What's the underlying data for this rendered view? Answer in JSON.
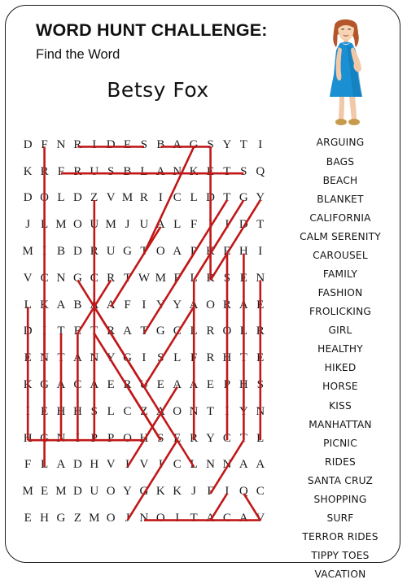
{
  "header": {
    "title": "WORD HUNT CHALLENGE:",
    "subtitle": "Find the Word",
    "puzzle_name": "Betsy Fox"
  },
  "illustration": {
    "name": "woman-in-blue-dress-illustration",
    "dress_color": "#1a8fd1",
    "hair_color": "#b4562a",
    "skin_color": "#f2c9a8",
    "shoe_color": "#c79a4e"
  },
  "grid": {
    "rows": 15,
    "cols": 15,
    "letters": [
      [
        "D",
        "F",
        "N",
        "R",
        "I",
        "D",
        "E",
        "S",
        "B",
        "A",
        "G",
        "S",
        "Y",
        "T",
        "I"
      ],
      [
        "K",
        "R",
        "F",
        "R",
        "U",
        "S",
        "B",
        "L",
        "A",
        "N",
        "K",
        "E",
        "T",
        "S",
        "Q"
      ],
      [
        "D",
        "O",
        "L",
        "D",
        "Z",
        "V",
        "M",
        "R",
        "I",
        "C",
        "L",
        "D",
        "T",
        "G",
        "Y"
      ],
      [
        "J",
        "L",
        "M",
        "O",
        "U",
        "M",
        "J",
        "U",
        "A",
        "L",
        "F",
        "I",
        "I",
        "D",
        "T"
      ],
      [
        "M",
        "I",
        "B",
        "D",
        "R",
        "U",
        "G",
        "T",
        "O",
        "A",
        "P",
        "K",
        "E",
        "H",
        "I"
      ],
      [
        "V",
        "C",
        "N",
        "G",
        "C",
        "R",
        "T",
        "W",
        "M",
        "F",
        "L",
        "R",
        "S",
        "E",
        "N"
      ],
      [
        "L",
        "K",
        "A",
        "B",
        "A",
        "A",
        "F",
        "I",
        "Y",
        "Y",
        "A",
        "O",
        "R",
        "A",
        "E"
      ],
      [
        "D",
        "I",
        "T",
        "E",
        "T",
        "R",
        "A",
        "T",
        "G",
        "C",
        "L",
        "R",
        "O",
        "L",
        "R"
      ],
      [
        "E",
        "N",
        "T",
        "A",
        "N",
        "Y",
        "G",
        "I",
        "S",
        "L",
        "F",
        "R",
        "H",
        "T",
        "E"
      ],
      [
        "K",
        "G",
        "A",
        "C",
        "A",
        "E",
        "R",
        "U",
        "E",
        "A",
        "A",
        "E",
        "P",
        "H",
        "S"
      ],
      [
        "I",
        "E",
        "H",
        "H",
        "S",
        "L",
        "C",
        "Z",
        "A",
        "O",
        "N",
        "T",
        "I",
        "Y",
        "N"
      ],
      [
        "H",
        "G",
        "N",
        "I",
        "P",
        "P",
        "O",
        "H",
        "S",
        "E",
        "R",
        "Y",
        "C",
        "T",
        "L"
      ],
      [
        "F",
        "L",
        "A",
        "D",
        "H",
        "V",
        "I",
        "V",
        "I",
        "C",
        "L",
        "N",
        "N",
        "A",
        "A"
      ],
      [
        "M",
        "E",
        "M",
        "D",
        "U",
        "O",
        "Y",
        "G",
        "K",
        "K",
        "J",
        "F",
        "I",
        "Q",
        "C"
      ],
      [
        "E",
        "H",
        "G",
        "Z",
        "M",
        "O",
        "J",
        "N",
        "O",
        "I",
        "T",
        "A",
        "C",
        "A",
        "V"
      ]
    ]
  },
  "solution": {
    "stroke_color": "#c01818",
    "stroke_width": 2.6,
    "lines": [
      {
        "word": "RIDES",
        "r1": 0,
        "c1": 3,
        "r2": 0,
        "c2": 7
      },
      {
        "word": "BAGS",
        "r1": 0,
        "c1": 8,
        "r2": 0,
        "c2": 11
      },
      {
        "word": "FRUS-BLANKETS",
        "r1": 1,
        "c1": 2,
        "r2": 1,
        "c2": 13
      },
      {
        "word": "SHOPPING",
        "r1": 11,
        "c1": 7,
        "r2": 11,
        "c2": 0
      },
      {
        "word": "VACATION",
        "r1": 14,
        "c1": 14,
        "r2": 14,
        "c2": 7
      },
      {
        "word": "COL1-DOWN",
        "r1": 0,
        "c1": 1,
        "r2": 9,
        "c2": 1
      },
      {
        "word": "COL4-DOWN",
        "r1": 2,
        "c1": 4,
        "r2": 10,
        "c2": 4
      },
      {
        "word": "COL11-DOWN",
        "r1": 0,
        "c1": 11,
        "r2": 5,
        "c2": 11
      },
      {
        "word": "COL13-DOWN",
        "r1": 4,
        "c1": 13,
        "r2": 11,
        "c2": 13
      },
      {
        "word": "COL12-DOWN",
        "r1": 4,
        "c1": 12,
        "r2": 11,
        "c2": 12
      },
      {
        "word": "COL0-DOWN",
        "r1": 6,
        "c1": 0,
        "r2": 11,
        "c2": 0
      },
      {
        "word": "COL1-DOWN2",
        "r1": 6,
        "c1": 1,
        "r2": 12,
        "c2": 1
      },
      {
        "word": "COL2-DOWN",
        "r1": 7,
        "c1": 2,
        "r2": 11,
        "c2": 2
      },
      {
        "word": "COL3-DOWN",
        "r1": 7,
        "c1": 3,
        "r2": 11,
        "c2": 3
      },
      {
        "word": "COL4-DOWN2",
        "r1": 7,
        "c1": 4,
        "r2": 11,
        "c2": 4
      },
      {
        "word": "COL10-DOWN",
        "r1": 5,
        "c1": 10,
        "r2": 11,
        "c2": 10
      },
      {
        "word": "COL14-DOWN",
        "r1": 5,
        "c1": 14,
        "r2": 11,
        "c2": 14
      },
      {
        "word": "DIAG-UPRIGHT1",
        "r1": 4,
        "c1": 7,
        "r2": 0,
        "c2": 10
      },
      {
        "word": "DIAG-UPRIGHT2",
        "r1": 5,
        "c1": 9,
        "r2": 2,
        "c2": 12
      },
      {
        "word": "DIAG-UPRIGHT3",
        "r1": 5,
        "c1": 10,
        "r2": 2,
        "c2": 13
      },
      {
        "word": "DIAG-UPRIGHT4",
        "r1": 5,
        "c1": 11,
        "r2": 2,
        "c2": 14
      },
      {
        "word": "DIAG-UPRIGHT5",
        "r1": 6,
        "c1": 5,
        "r2": 3,
        "c2": 8
      },
      {
        "word": "DIAG-UPRIGHT6",
        "r1": 7,
        "c1": 7,
        "r2": 4,
        "c2": 10
      },
      {
        "word": "DIAG-DOWNRT1",
        "r1": 5,
        "c1": 3,
        "r2": 8,
        "c2": 6
      },
      {
        "word": "DIAG-DOWNRT2",
        "r1": 6,
        "c1": 4,
        "r2": 9,
        "c2": 7
      },
      {
        "word": "DIAG-DOWNRT3",
        "r1": 7,
        "c1": 4,
        "r2": 11,
        "c2": 8
      },
      {
        "word": "DIAG-DOWNRT4",
        "r1": 8,
        "c1": 6,
        "r2": 12,
        "c2": 10
      },
      {
        "word": "DIAG-UPRT7",
        "r1": 9,
        "c1": 7,
        "r2": 6,
        "c2": 10
      },
      {
        "word": "DIAG-V1",
        "r1": 5,
        "c1": 5,
        "r2": 7,
        "c2": 3
      },
      {
        "word": "DIAG-V2",
        "r1": 9,
        "c1": 6,
        "r2": 11,
        "c2": 8
      },
      {
        "word": "DIAG-DOWN-LEFT",
        "r1": 9,
        "c1": 9,
        "r2": 12,
        "c2": 6
      },
      {
        "word": "DIAG-LEFT2",
        "r1": 11,
        "c1": 9,
        "r2": 14,
        "c2": 6
      },
      {
        "word": "DIAG-LEFT3",
        "r1": 11,
        "c1": 13,
        "r2": 13,
        "c2": 11
      },
      {
        "word": "DIAG-LEFT4",
        "r1": 13,
        "c1": 12,
        "r2": 14,
        "c2": 11
      },
      {
        "word": "DIAG-RT-END",
        "r1": 13,
        "c1": 13,
        "r2": 14,
        "c2": 14
      }
    ]
  },
  "wordlist": [
    "ARGUING",
    "BAGS",
    "BEACH",
    "BLANKET",
    "CALIFORNIA",
    "CALM SERENITY",
    "CAROUSEL",
    "FAMILY",
    "FASHION",
    "FROLICKING",
    "GIRL",
    "HEALTHY",
    "HIKED",
    "HORSE",
    "KISS",
    "MANHATTAN",
    "PICNIC",
    "RIDES",
    "SANTA CRUZ",
    "SHOPPING",
    "SURF",
    "TERROR RIDES",
    "TIPPY TOES",
    "VACATION"
  ]
}
